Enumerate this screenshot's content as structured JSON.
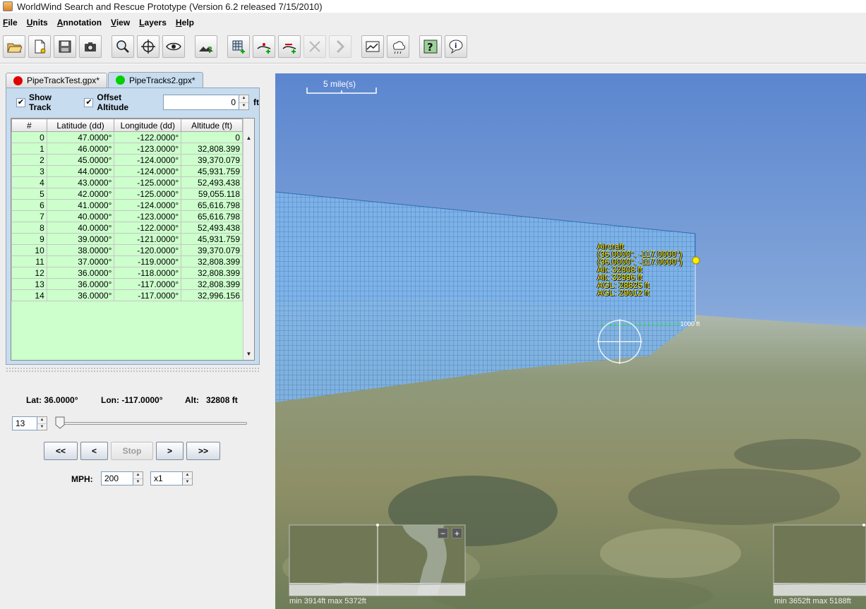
{
  "window": {
    "title": "WorldWind Search and Rescue Prototype (Version 6.2 released 7/15/2010)"
  },
  "menu": [
    "File",
    "Units",
    "Annotation",
    "View",
    "Layers",
    "Help"
  ],
  "toolbar": {
    "buttons": [
      "open-folder-icon",
      "new-file-icon",
      "save-icon",
      "camera-icon",
      "zoom-to-icon",
      "crosshair-icon",
      "eye-icon",
      "terrain-help-icon",
      "grid-add-icon",
      "add-point-icon",
      "add-line-icon",
      "disabled-cross-icon",
      "disabled-arrow-icon",
      "chart-icon",
      "cloud-icon",
      "help-icon",
      "speech-bubble-icon"
    ]
  },
  "tabs": [
    {
      "label": "PipeTrackTest.gpx*",
      "color": "#e00000"
    },
    {
      "label": "PipeTracks2.gpx*",
      "color": "#00d000"
    }
  ],
  "track_panel": {
    "show_track_label": "Show Track",
    "offset_altitude_label": "Offset Altitude",
    "offset_value": "0",
    "offset_unit": "ft",
    "columns": [
      "#",
      "Latitude (dd)",
      "Longitude (dd)",
      "Altitude (ft)"
    ],
    "rows": [
      [
        "0",
        "47.0000°",
        "-122.0000°",
        "0"
      ],
      [
        "1",
        "46.0000°",
        "-123.0000°",
        "32,808.399"
      ],
      [
        "2",
        "45.0000°",
        "-124.0000°",
        "39,370.079"
      ],
      [
        "3",
        "44.0000°",
        "-124.0000°",
        "45,931.759"
      ],
      [
        "4",
        "43.0000°",
        "-125.0000°",
        "52,493.438"
      ],
      [
        "5",
        "42.0000°",
        "-125.0000°",
        "59,055.118"
      ],
      [
        "6",
        "41.0000°",
        "-124.0000°",
        "65,616.798"
      ],
      [
        "7",
        "40.0000°",
        "-123.0000°",
        "65,616.798"
      ],
      [
        "8",
        "40.0000°",
        "-122.0000°",
        "52,493.438"
      ],
      [
        "9",
        "39.0000°",
        "-121.0000°",
        "45,931.759"
      ],
      [
        "10",
        "38.0000°",
        "-120.0000°",
        "39,370.079"
      ],
      [
        "11",
        "37.0000°",
        "-119.0000°",
        "32,808.399"
      ],
      [
        "12",
        "36.0000°",
        "-118.0000°",
        "32,808.399"
      ],
      [
        "13",
        "36.0000°",
        "-117.0000°",
        "32,808.399"
      ],
      [
        "14",
        "36.0000°",
        "-117.0000°",
        "32,996.156"
      ]
    ]
  },
  "position": {
    "lat_label": "Lat:",
    "lat": "36.0000°",
    "lon_label": "Lon:",
    "lon": "-117.0000°",
    "alt_label": "Alt:",
    "alt": "32808 ft"
  },
  "player": {
    "index": "13",
    "slider_fraction": 0.0,
    "buttons": [
      "<<",
      "<",
      "Stop",
      ">",
      ">>"
    ],
    "mph_label": "MPH:",
    "mph": "200",
    "multiplier": "x1"
  },
  "globe": {
    "scale": "5 mile(s)",
    "callout": [
      "Aircraft",
      "(36.0000°, -117.0000°)",
      "(36.0000°, -117.0000°)",
      "Alt: 32808 ft",
      "Alt: 32996 ft",
      "AGL: 28825 ft",
      "AGL: 29012 ft"
    ],
    "agl_marker": "1000 ft",
    "profile_left": "min 3914ft   max 5372ft",
    "profile_right": "min 3652ft   max 5188ft",
    "minus": "−",
    "plus": "+"
  }
}
